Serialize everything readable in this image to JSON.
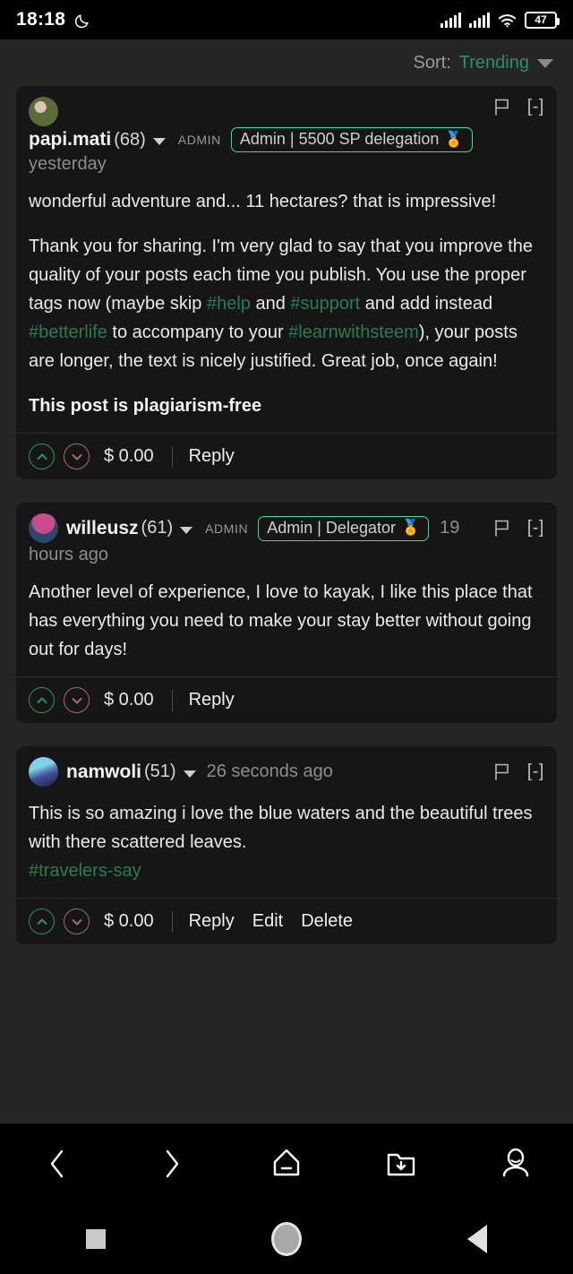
{
  "statusbar": {
    "time": "18:18",
    "moon_icon": "crescent-moon-icon",
    "signal1_icon": "signal-bars-icon",
    "signal2_icon": "signal-bars-icon",
    "wifi_icon": "wifi-icon",
    "battery_level": "47"
  },
  "sort": {
    "label": "Sort:",
    "value": "Trending",
    "caret_icon": "chevron-down-icon"
  },
  "comments": [
    {
      "author": "papi.mati",
      "reputation": "(68)",
      "admin_label": "ADMIN",
      "badge": "Admin | 5500 SP delegation",
      "badge_medal": "🏅",
      "time": "yesterday",
      "time_wrap": "",
      "flag_icon": "flag-icon",
      "collapse": "[-]",
      "avatar_name": "avatar-papi-mati",
      "body": [
        {
          "type": "text",
          "text": "wonderful adventure and... 11 hectares? that is impressive!"
        },
        {
          "type": "rich",
          "segments": [
            {
              "t": "Thank you for sharing. I'm very glad to say that you improve the quality of your posts each time you publish. You use the proper tags now (maybe skip ",
              "tag": false
            },
            {
              "t": "#help",
              "tag": true
            },
            {
              "t": " and ",
              "tag": false
            },
            {
              "t": "#support",
              "tag": true
            },
            {
              "t": " and add instead ",
              "tag": false
            },
            {
              "t": "#betterlife",
              "tag": true
            },
            {
              "t": " to accompany to your ",
              "tag": false
            },
            {
              "t": "#learnwithsteem",
              "tag": true
            },
            {
              "t": "), your posts are longer, the text is nicely justified. Great job, once again!",
              "tag": false
            }
          ]
        },
        {
          "type": "bold",
          "text": "This post is plagiarism-free"
        }
      ],
      "payout": "$ 0.00",
      "actions": [
        "Reply"
      ],
      "upvote_icon": "upvote-icon",
      "downvote_icon": "downvote-icon"
    },
    {
      "author": "willeusz",
      "reputation": "(61)",
      "admin_label": "ADMIN",
      "badge": "Admin | Delegator",
      "badge_medal": "🏅",
      "time": "19",
      "time_wrap": "hours ago",
      "flag_icon": "flag-icon",
      "collapse": "[-]",
      "avatar_name": "avatar-willeusz",
      "body": [
        {
          "type": "text",
          "text": "Another level of experience, I love to kayak, I like this place that has everything you need to make your stay better without going out for days!"
        }
      ],
      "payout": "$ 0.00",
      "actions": [
        "Reply"
      ],
      "upvote_icon": "upvote-icon",
      "downvote_icon": "downvote-icon"
    },
    {
      "author": "namwoli",
      "reputation": "(51)",
      "admin_label": "",
      "badge": "",
      "badge_medal": "",
      "time": "26 seconds ago",
      "time_wrap": "",
      "flag_icon": "flag-icon",
      "collapse": "[-]",
      "avatar_name": "avatar-namwoli",
      "body": [
        {
          "type": "text",
          "text": "This is so amazing i love the blue waters and the beautiful trees with there scattered leaves."
        },
        {
          "type": "tagline",
          "text": "#travelers-say"
        }
      ],
      "payout": "$ 0.00",
      "actions": [
        "Reply",
        "Edit",
        "Delete"
      ],
      "upvote_icon": "upvote-icon",
      "downvote_icon": "downvote-icon"
    }
  ],
  "browser_nav": [
    {
      "name": "back-icon"
    },
    {
      "name": "forward-icon"
    },
    {
      "name": "home-icon"
    },
    {
      "name": "downloads-folder-icon"
    },
    {
      "name": "profile-icon"
    }
  ],
  "system_nav": [
    {
      "name": "recents-square-icon"
    },
    {
      "name": "home-circle-icon"
    },
    {
      "name": "back-triangle-icon"
    }
  ],
  "colors": {
    "page_bg": "#252525",
    "card_bg": "#161616",
    "accent_green": "#3fdc9a",
    "link_green": "#2f7a55",
    "sort_green": "#2f8f63",
    "downvote_red": "#a36b72"
  }
}
